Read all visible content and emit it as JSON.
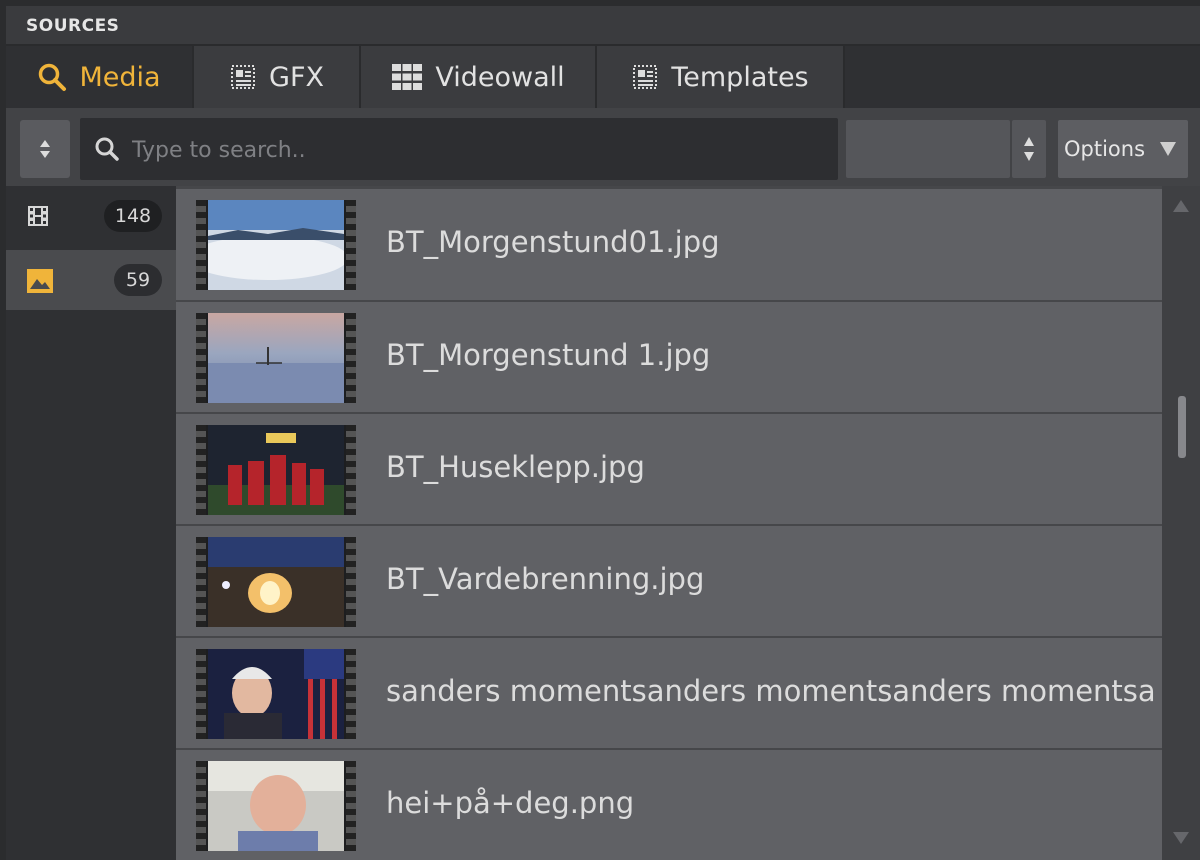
{
  "panel": {
    "title": "SOURCES"
  },
  "tabs": [
    {
      "label": "Media",
      "icon": "search-icon",
      "active": true
    },
    {
      "label": "GFX",
      "icon": "gfx-icon",
      "active": false
    },
    {
      "label": "Videowall",
      "icon": "videowall-icon",
      "active": false
    },
    {
      "label": "Templates",
      "icon": "templates-icon",
      "active": false
    }
  ],
  "toolbar": {
    "search_placeholder": "Type to search..",
    "search_value": "",
    "filter_value": "",
    "options_label": "Options"
  },
  "sidebar": {
    "items": [
      {
        "icon": "film-icon",
        "count": "148",
        "active": false
      },
      {
        "icon": "image-icon",
        "count": "59",
        "active": true
      }
    ]
  },
  "media_list": [
    {
      "name": "BT_Morgenstund01.jpg"
    },
    {
      "name": "BT_Morgenstund 1.jpg"
    },
    {
      "name": "BT_Huseklepp.jpg"
    },
    {
      "name": "BT_Vardebrenning.jpg"
    },
    {
      "name": "sanders momentsanders momentsanders momentsa"
    },
    {
      "name": "hei+på+deg.png"
    }
  ],
  "colors": {
    "accent": "#f0b43a",
    "panel_bg": "#35363a",
    "row_bg": "#606165",
    "text": "#dcdcdc"
  }
}
